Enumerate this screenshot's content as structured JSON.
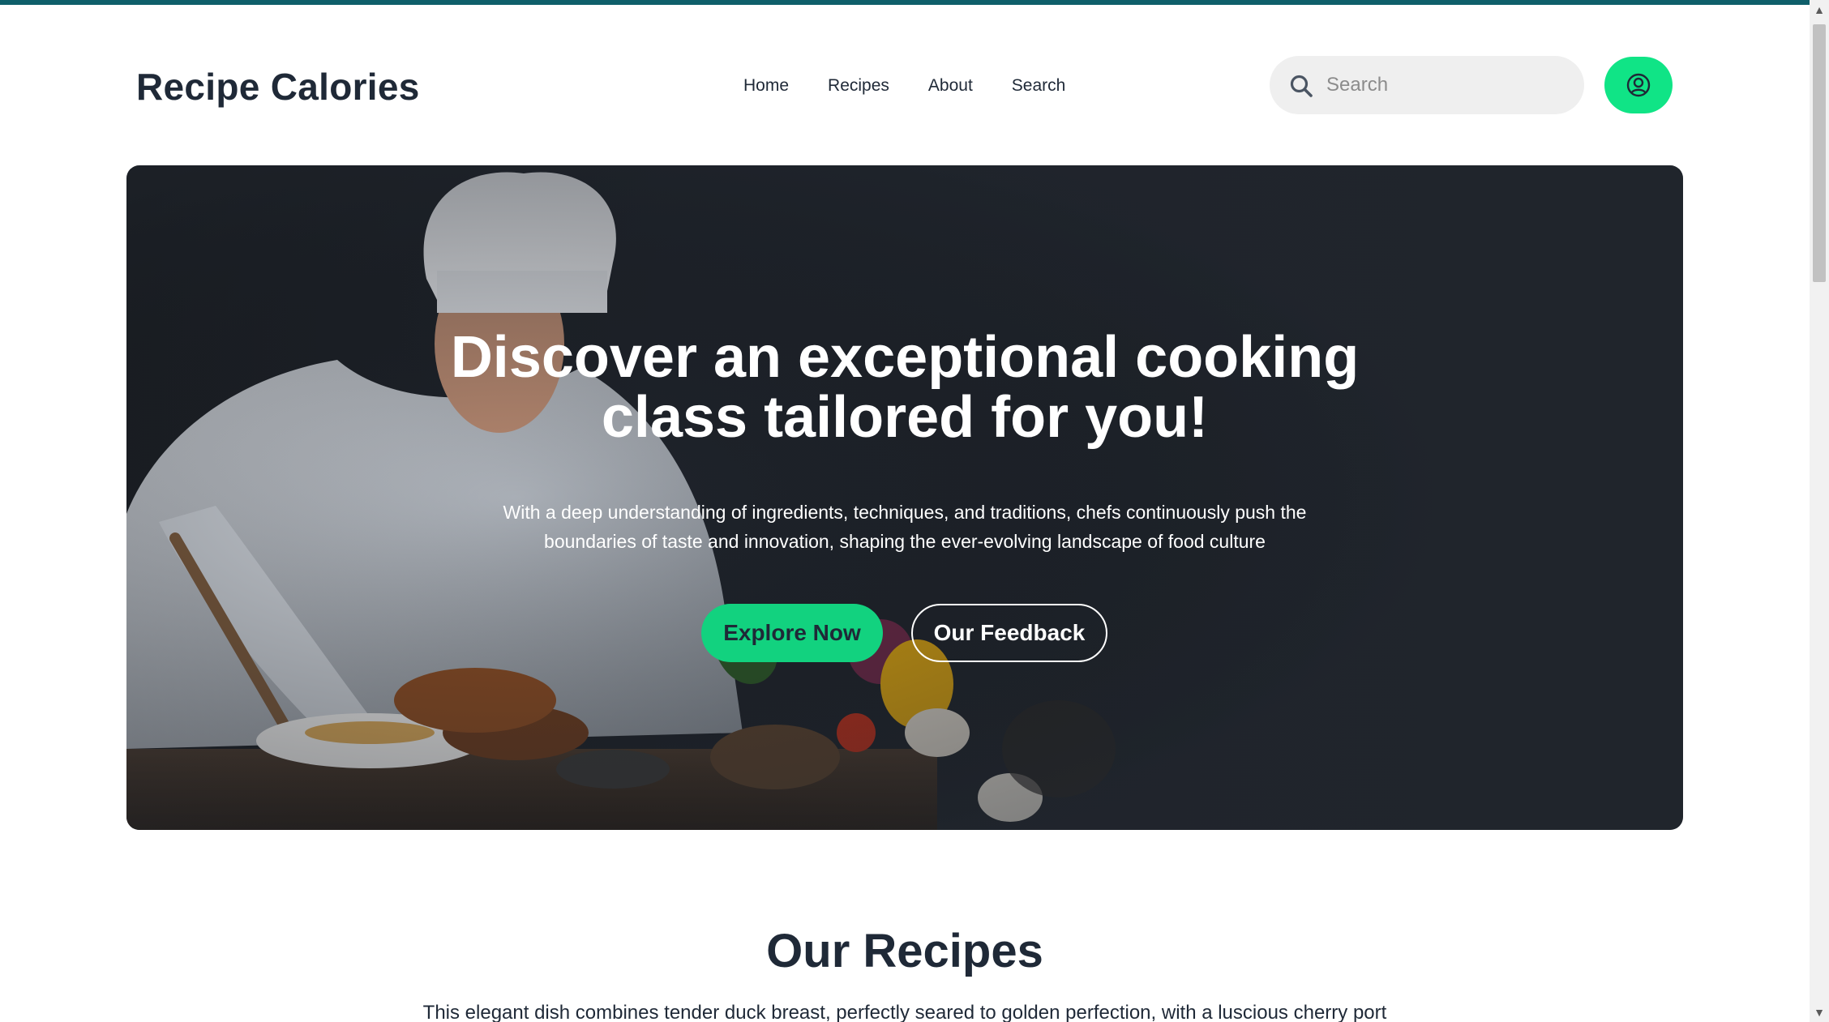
{
  "brand": {
    "title": "Recipe Calories"
  },
  "nav": {
    "items": [
      {
        "label": "Home"
      },
      {
        "label": "Recipes"
      },
      {
        "label": "About"
      },
      {
        "label": "Search"
      }
    ]
  },
  "search": {
    "placeholder": "Search",
    "icon": "search-icon"
  },
  "account": {
    "icon": "user-circle-icon"
  },
  "hero": {
    "title_line1": "Discover an exceptional cooking",
    "title_line2": "class tailored for you!",
    "subtitle_line1": "With a deep understanding of ingredients, techniques, and traditions, chefs continuously push the",
    "subtitle_line2": "boundaries of taste and innovation, shaping the ever-evolving landscape of food culture",
    "primary_button": "Explore Now",
    "secondary_button": "Our Feedback",
    "image": "chef-cooking-illustration"
  },
  "recipes_section": {
    "title": "Our Recipes",
    "text": "This elegant dish combines tender duck breast, perfectly seared to golden perfection, with a luscious cherry port"
  },
  "colors": {
    "accent": "#10e486",
    "primary_button": "#12d27f",
    "text_dark": "#1f2937",
    "top_bar": "#0f5f6a",
    "hero_bg": "#20252d"
  }
}
